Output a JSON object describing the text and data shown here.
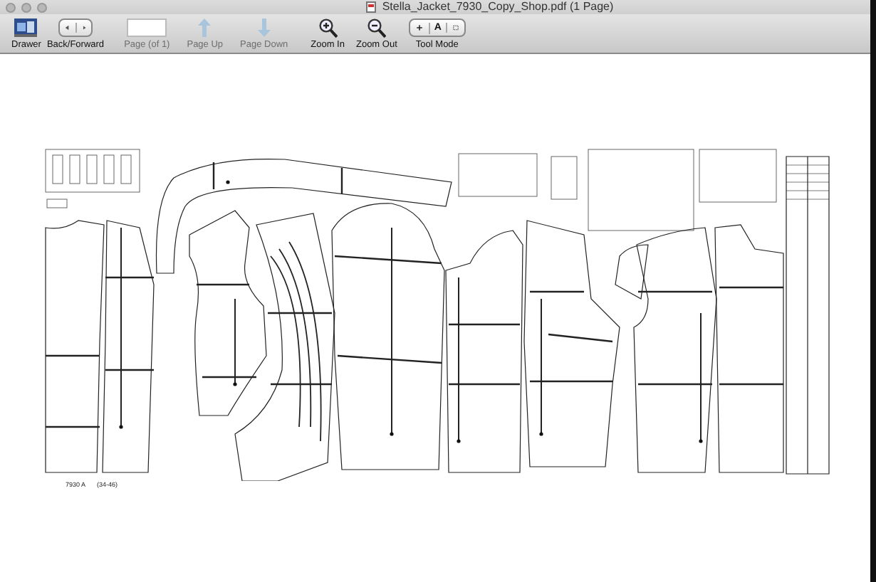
{
  "window": {
    "title": "Stella_Jacket_7930_Copy_Shop.pdf (1 Page)"
  },
  "toolbar": [
    {
      "kind": "drawer",
      "label": "Drawer",
      "disabled": false
    },
    {
      "kind": "back_forward",
      "label": "Back/Forward",
      "disabled": false
    },
    {
      "kind": "page_field",
      "label": "Page (of 1)",
      "disabled": true
    },
    {
      "kind": "page_up",
      "label": "Page Up",
      "disabled": true
    },
    {
      "kind": "page_down",
      "label": "Page Down",
      "disabled": true
    },
    {
      "kind": "zoom_in",
      "label": "Zoom In",
      "disabled": false
    },
    {
      "kind": "zoom_out",
      "label": "Zoom Out",
      "disabled": false
    },
    {
      "kind": "tool_mode",
      "label": "Tool Mode",
      "disabled": false,
      "segments": [
        {
          "kind": "select"
        },
        {
          "kind": "text",
          "label": "A"
        },
        {
          "kind": "rect"
        }
      ]
    }
  ],
  "document": {
    "footer_code": "7930 A",
    "footer_sizes": "(34-46)"
  }
}
